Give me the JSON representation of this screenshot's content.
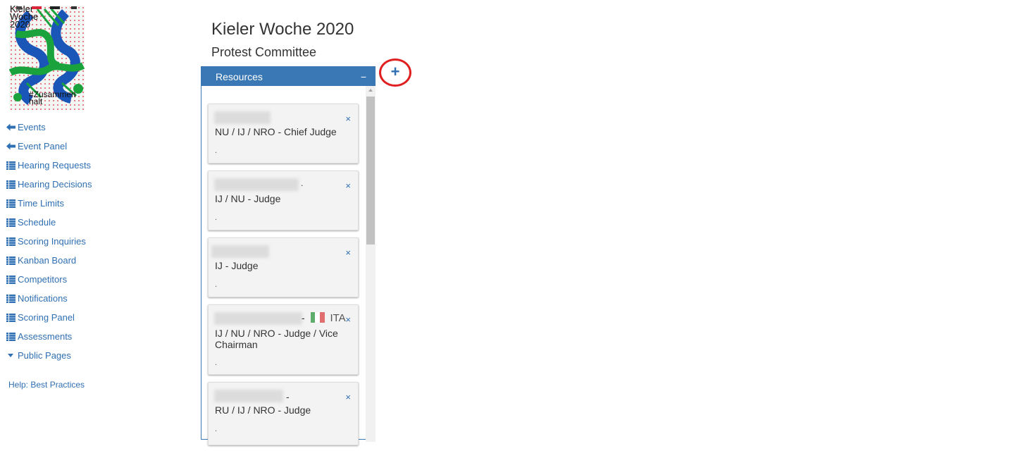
{
  "logo": {
    "text_lines": [
      "Kieler",
      "Woche",
      "2020"
    ],
    "tagline": "#Zusammen halt",
    "colors": {
      "blue": "#1a55b8",
      "green": "#1aa33c",
      "dots": "#d9263a"
    }
  },
  "header": {
    "title": "Kieler Woche 2020",
    "subtitle": "Protest Committee"
  },
  "sidebar": {
    "items": [
      {
        "label": "Events",
        "icon": "arrow-left-icon"
      },
      {
        "label": "Event Panel",
        "icon": "arrow-left-icon"
      },
      {
        "label": "Hearing Requests",
        "icon": "list-icon"
      },
      {
        "label": "Hearing Decisions",
        "icon": "list-icon"
      },
      {
        "label": "Time Limits",
        "icon": "list-icon"
      },
      {
        "label": "Schedule",
        "icon": "list-icon"
      },
      {
        "label": "Scoring Inquiries",
        "icon": "list-icon"
      },
      {
        "label": "Kanban Board",
        "icon": "list-icon"
      },
      {
        "label": "Competitors",
        "icon": "list-icon"
      },
      {
        "label": "Notifications",
        "icon": "list-icon"
      },
      {
        "label": "Scoring Panel",
        "icon": "list-icon"
      },
      {
        "label": "Assessments",
        "icon": "list-icon"
      },
      {
        "label": "Public Pages",
        "icon": "caret-down-icon"
      }
    ],
    "help": "Help: Best Practices"
  },
  "panel": {
    "title": "Resources",
    "collapse_symbol": "−",
    "add_symbol": "+",
    "accent_color": "#3a78b5",
    "cards": [
      {
        "role": "NU / IJ / NRO - Chief Judge",
        "close": "×",
        "dot": "."
      },
      {
        "role": "IJ / NU - Judge",
        "close": "×",
        "dot": ".",
        "name_suffix": "."
      },
      {
        "role": "IJ - Judge",
        "close": "×",
        "dot": "."
      },
      {
        "role": "IJ / NU / NRO - Judge / Vice Chairman",
        "close": "×",
        "dot": ".",
        "name_suffix": "-",
        "country": "ITA"
      },
      {
        "role": "RU / IJ / NRO - Judge",
        "close": "×",
        "dot": ".",
        "name_suffix": "-"
      }
    ]
  }
}
